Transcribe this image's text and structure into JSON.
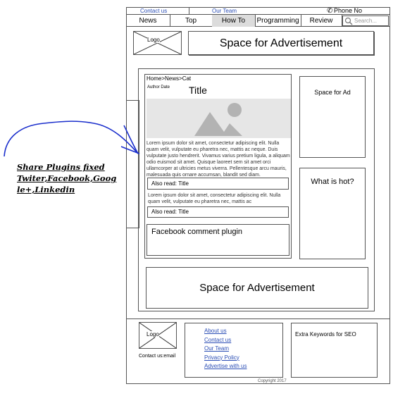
{
  "header": {
    "contact_link": "Contact us",
    "team_link": "Our Team",
    "phone": "Phone No"
  },
  "nav": {
    "items": [
      "News",
      "Top",
      "How To",
      "Programming",
      "Review"
    ],
    "search_placeholder": "Search..."
  },
  "top_banner": {
    "logo": "Logo",
    "ad": "Space for Advertisement"
  },
  "article": {
    "breadcrumb": "Home>News>Cat",
    "author_date": "Author Date",
    "title": "Title",
    "lorem_1": "Lorem ipsum dolor sit amet, consectetur adipiscing elit. Nulla quam velit, vulputate eu pharetra nec, mattis ac neque. Duis vulputate justo hendrerit. Vivamus varius pretium ligula, a aliquam odio euismod sit amet. Quisque laoreet sem sit amet orci ullamcorper at ultricies metus viverra. Pellentesque arcu mauris, malesuada quis ornare accumsan, blandit sed diam.",
    "also_read_1": "Also read: Title",
    "lorem_2": "Lorem ipsum dolor sit amet, consectetur adipiscing elit. Nulla quam velit, vulputate eu pharetra nec, mattis ac",
    "also_read_2": "Also read: Title",
    "facebook_comments": "Facebook comment plugin"
  },
  "sidebar": {
    "ad": "Space for Ad",
    "hot": "What is hot?"
  },
  "bottom_ad": "Space for Advertisement",
  "annotation": {
    "text": "Share Plugins fixed Twiter,Facebook,Goog le+,Linkedin"
  },
  "footer": {
    "logo": "Logo",
    "contact": "Contact us:email",
    "links": [
      "About us",
      "Contact us",
      "Our Team",
      "Privacy Policy",
      "Advertise with us"
    ],
    "keywords": "Extra Keywords for SEO",
    "copyright": "Copyright 2017"
  },
  "colors": {
    "link": "#2b4eb5",
    "annotation_ink": "#1a2ecc",
    "nav_active": "#dcdcdc",
    "image_placeholder": "#e6e6e6"
  }
}
